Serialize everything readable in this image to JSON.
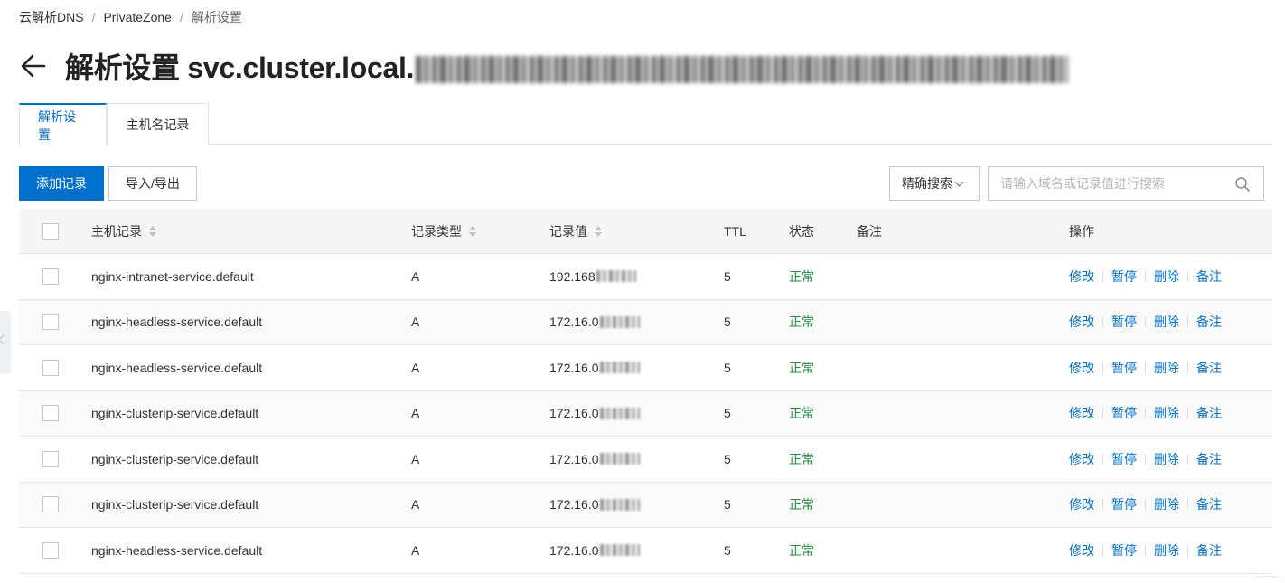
{
  "breadcrumb": {
    "items": [
      "云解析DNS",
      "PrivateZone",
      "解析设置"
    ],
    "separator": "/"
  },
  "header": {
    "title": "解析设置 svc.cluster.local."
  },
  "tabs": [
    {
      "label": "解析设置",
      "active": true
    },
    {
      "label": "主机名记录",
      "active": false
    }
  ],
  "toolbar": {
    "add_label": "添加记录",
    "import_export_label": "导入/导出",
    "search_mode_label": "精确搜索",
    "search_placeholder": "请输入域名或记录值进行搜索",
    "search_value": ""
  },
  "table": {
    "columns": [
      "主机记录",
      "记录类型",
      "记录值",
      "TTL",
      "状态",
      "备注",
      "操作"
    ],
    "rows": [
      {
        "host": "nginx-intranet-service.default",
        "type": "A",
        "value": "192.168",
        "ttl": "5",
        "status": "正常",
        "note": ""
      },
      {
        "host": "nginx-headless-service.default",
        "type": "A",
        "value": "172.16.0",
        "ttl": "5",
        "status": "正常",
        "note": ""
      },
      {
        "host": "nginx-headless-service.default",
        "type": "A",
        "value": "172.16.0",
        "ttl": "5",
        "status": "正常",
        "note": ""
      },
      {
        "host": "nginx-clusterip-service.default",
        "type": "A",
        "value": "172.16.0",
        "ttl": "5",
        "status": "正常",
        "note": ""
      },
      {
        "host": "nginx-clusterip-service.default",
        "type": "A",
        "value": "172.16.0",
        "ttl": "5",
        "status": "正常",
        "note": ""
      },
      {
        "host": "nginx-clusterip-service.default",
        "type": "A",
        "value": "172.16.0",
        "ttl": "5",
        "status": "正常",
        "note": ""
      },
      {
        "host": "nginx-headless-service.default",
        "type": "A",
        "value": "172.16.0",
        "ttl": "5",
        "status": "正常",
        "note": ""
      }
    ],
    "actions": [
      "修改",
      "暂停",
      "删除",
      "备注"
    ]
  },
  "colors": {
    "primary": "#0070cc",
    "status_ok": "#1e8e3e",
    "header_bg": "#f5f5f5"
  },
  "icons": {
    "back": "arrow-left-icon",
    "search": "search-icon",
    "dropdown": "chevron-down-icon",
    "sort": "sort-icon",
    "collapse": "chevron-left-icon"
  }
}
